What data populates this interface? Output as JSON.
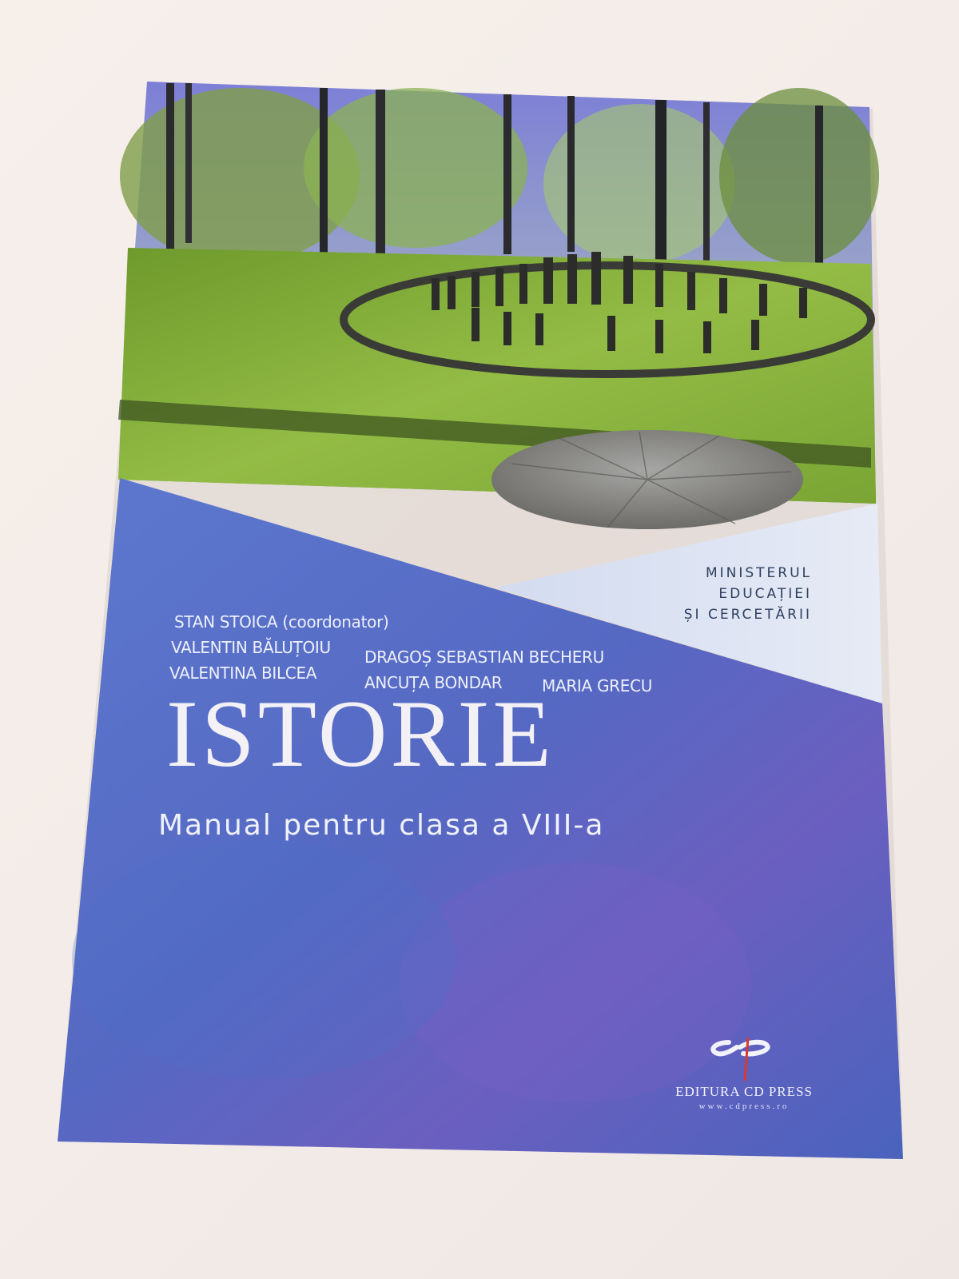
{
  "cover": {
    "ministry": [
      "MINISTERUL",
      "EDUCAȚIEI",
      "ȘI CERCETĂRII"
    ],
    "authors": [
      "STAN STOICA (coordonator)",
      "VALENTIN BĂLUȚOIU",
      "DRAGOȘ SEBASTIAN BECHERU",
      "VALENTINA BILCEA",
      "ANCUȚA BONDAR",
      "MARIA GRECU"
    ],
    "title": "ISTORIE",
    "subtitle": "Manual pentru clasa a VIII-a",
    "publisher": {
      "name": "EDITURA CD PRESS",
      "url": "www.cdpress.ro"
    }
  },
  "colors": {
    "background": "#f3ece8",
    "cover_blue": "#5a72c8",
    "cover_blue_dark": "#4a5fb8",
    "cover_light_panel": "#dfe5f3",
    "grass": "#7ea83a",
    "stone": "#8a8a88"
  }
}
